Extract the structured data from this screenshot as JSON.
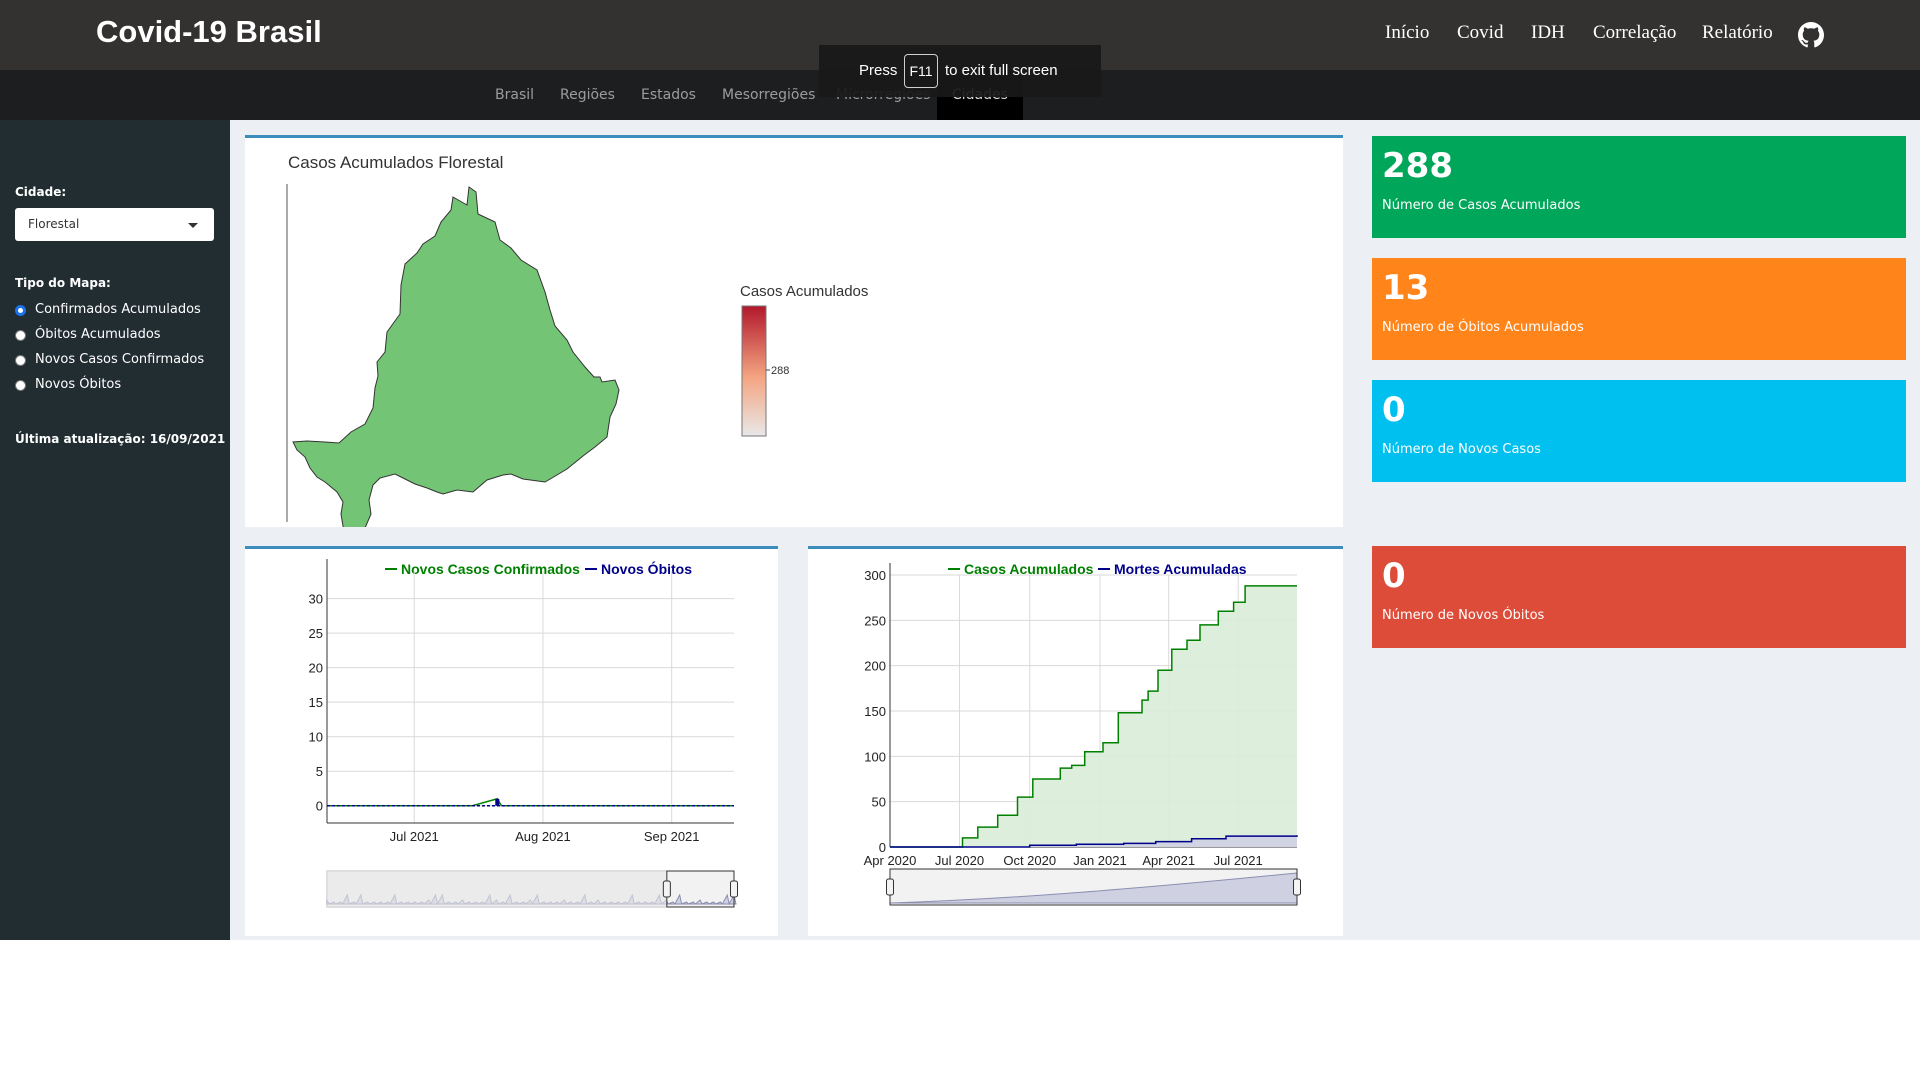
{
  "app": {
    "brand": "Covid-19 Brasil",
    "nav": [
      "Início",
      "Covid",
      "IDH",
      "Correlação",
      "Relatório"
    ],
    "github_icon": "github-icon"
  },
  "subnav": {
    "tabs": [
      "Brasil",
      "Regiões",
      "Estados",
      "Mesorregiões",
      "Microrregiões",
      "Cidades"
    ],
    "active": "Cidades"
  },
  "fullscreen_notice": {
    "before": "Press",
    "key": "F11",
    "after": "to exit full screen"
  },
  "sidebar": {
    "city_label": "Cidade:",
    "city_value": "Florestal",
    "map_type_label": "Tipo do Mapa:",
    "map_types": [
      "Confirmados Acumulados",
      "Óbitos Acumulados",
      "Novos Casos Confirmados",
      "Novos Óbitos"
    ],
    "map_type_selected": "Confirmados Acumulados",
    "last_update": "Última atualização: 16/09/2021"
  },
  "map": {
    "title": "Casos Acumulados Florestal",
    "legend_title": "Casos Acumulados",
    "legend_tick": "288",
    "fill_color": "#74c476"
  },
  "value_boxes": [
    {
      "value": "288",
      "label": "Número de Casos Acumulados",
      "color": "#00a65a"
    },
    {
      "value": "13",
      "label": "Número de Óbitos Acumulados",
      "color": "#ff851b"
    },
    {
      "value": "0",
      "label": "Número de Novos Casos",
      "color": "#00c0ef"
    },
    {
      "value": "0",
      "label": "Número de Novos Óbitos",
      "color": "#dd4b39"
    }
  ],
  "chart_data": [
    {
      "type": "line",
      "legend": "top",
      "grid": true,
      "series": [
        {
          "name": "Novos Casos Confirmados",
          "color": "#008000",
          "x": [
            "2021-06-10",
            "2021-07-01",
            "2021-07-15",
            "2021-07-21",
            "2021-07-22",
            "2021-08-01",
            "2021-08-15",
            "2021-09-01",
            "2021-09-16"
          ],
          "values": [
            0,
            0,
            0,
            1,
            0,
            0,
            0,
            0,
            0
          ]
        },
        {
          "name": "Novos Óbitos",
          "color": "#00008b",
          "x": [
            "2021-06-10",
            "2021-07-01",
            "2021-07-15",
            "2021-07-21",
            "2021-07-22",
            "2021-08-01",
            "2021-08-15",
            "2021-09-01",
            "2021-09-16"
          ],
          "values": [
            0,
            0,
            0,
            0,
            0,
            0,
            0,
            0,
            0
          ]
        }
      ],
      "x_range": [
        "2021-06-10",
        "2021-09-16"
      ],
      "x_ticks": [
        {
          "date": "2021-07-01",
          "label": "Jul 2021"
        },
        {
          "date": "2021-08-01",
          "label": "Aug 2021"
        },
        {
          "date": "2021-09-01",
          "label": "Sep 2021"
        }
      ],
      "ylim": [
        -2.5,
        34
      ],
      "y_ticks": [
        0,
        5,
        10,
        15,
        20,
        25,
        30
      ],
      "range_slider": true
    },
    {
      "type": "area",
      "legend": "top",
      "grid": true,
      "series": [
        {
          "name": "Casos Acumulados",
          "color": "#008000",
          "fill": "#d9ecd8",
          "x": [
            "2020-04-01",
            "2020-06-12",
            "2020-07-05",
            "2020-07-25",
            "2020-08-20",
            "2020-09-15",
            "2020-10-05",
            "2020-11-10",
            "2020-11-25",
            "2020-12-12",
            "2021-01-05",
            "2021-01-25",
            "2021-02-25",
            "2021-03-05",
            "2021-03-18",
            "2021-04-05",
            "2021-04-25",
            "2021-05-12",
            "2021-06-05",
            "2021-06-25",
            "2021-07-10"
          ],
          "values": [
            0,
            0,
            10,
            22,
            35,
            55,
            75,
            87,
            90,
            105,
            115,
            148,
            162,
            172,
            195,
            218,
            228,
            245,
            260,
            270,
            288
          ]
        },
        {
          "name": "Mortes Acumuladas",
          "color": "#00008b",
          "fill": "#cfd0e2",
          "x": [
            "2020-04-01",
            "2020-09-01",
            "2020-10-01",
            "2020-12-01",
            "2021-02-01",
            "2021-03-15",
            "2021-05-01",
            "2021-06-15",
            "2021-09-16"
          ],
          "values": [
            0,
            0,
            2,
            3,
            4,
            6,
            9,
            12,
            13
          ]
        }
      ],
      "x_range": [
        "2020-04-01",
        "2021-09-16"
      ],
      "x_ticks": [
        {
          "date": "2020-04-01",
          "label": "Apr 2020"
        },
        {
          "date": "2020-07-01",
          "label": "Jul 2020"
        },
        {
          "date": "2020-10-01",
          "label": "Oct 2020"
        },
        {
          "date": "2021-01-01",
          "label": "Jan 2021"
        },
        {
          "date": "2021-04-01",
          "label": "Apr 2021"
        },
        {
          "date": "2021-07-01",
          "label": "Jul 2021"
        }
      ],
      "ylim": [
        0,
        300
      ],
      "y_ticks": [
        0,
        50,
        100,
        150,
        200,
        250,
        300
      ],
      "range_slider": true
    }
  ]
}
